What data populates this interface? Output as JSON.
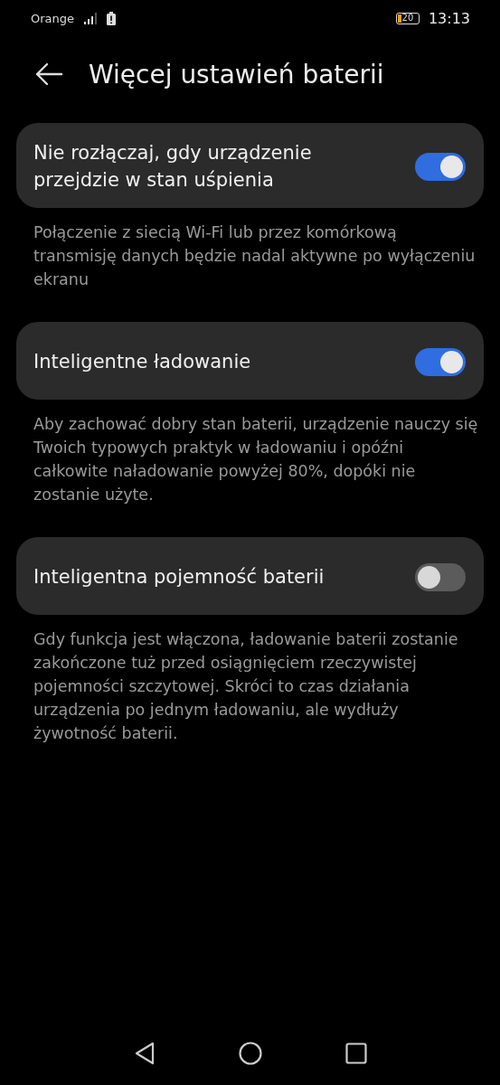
{
  "status_bar": {
    "carrier": "Orange",
    "battery": "20",
    "time": "13:13"
  },
  "title": "Więcej ustawień baterii",
  "settings": [
    {
      "label": "Nie rozłączaj, gdy urządzenie przejdzie w stan uśpienia",
      "on": true,
      "description": "Połączenie z siecią Wi-Fi lub przez komórkową transmisję danych będzie nadal aktywne po wyłączeniu ekranu"
    },
    {
      "label": "Inteligentne ładowanie",
      "on": true,
      "description": "Aby zachować dobry stan baterii, urządzenie nauczy się Twoich typowych praktyk w ładowaniu i opóźni całkowite naładowanie powyżej 80%, dopóki nie zostanie użyte."
    },
    {
      "label": "Inteligentna pojemność baterii",
      "on": false,
      "description": "Gdy funkcja jest włączona, ładowanie baterii zostanie zakończone tuż przed osiągnięciem rzeczywistej pojemności szczytowej. Skróci to czas działania urządzenia po jednym ładowaniu, ale wydłuży żywotność baterii."
    }
  ]
}
